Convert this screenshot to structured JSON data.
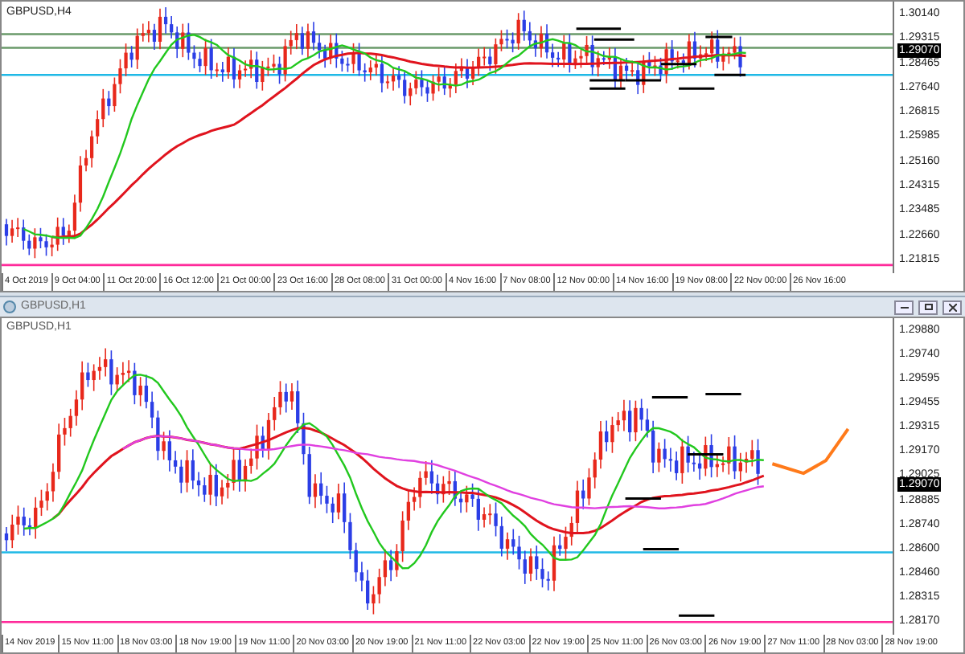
{
  "top_chart": {
    "title": "GBPUSD,H4",
    "price_tag": "1.29070",
    "price_axis": [
      "1.30140",
      "1.29315",
      "1.28465",
      "1.27640",
      "1.26815",
      "1.25985",
      "1.25160",
      "1.24315",
      "1.23485",
      "1.22660",
      "1.21815"
    ],
    "time_axis": [
      "4 Oct 2019",
      "9 Oct 04:00",
      "11 Oct 20:00",
      "16 Oct 12:00",
      "21 Oct 00:00",
      "23 Oct 16:00",
      "28 Oct 08:00",
      "31 Oct 00:00",
      "4 Nov 16:00",
      "7 Nov 08:00",
      "12 Nov 00:00",
      "14 Nov 16:00",
      "19 Nov 08:00",
      "22 Nov 00:00",
      "26 Nov 16:00"
    ]
  },
  "bottom_window": {
    "title": "GBPUSD,H1",
    "chart_title": "GBPUSD,H1",
    "price_tag": "1.29070",
    "price_axis": [
      "1.29880",
      "1.29740",
      "1.29595",
      "1.29455",
      "1.29315",
      "1.29170",
      "1.29025",
      "1.28885",
      "1.28740",
      "1.28600",
      "1.28460",
      "1.28315",
      "1.28170"
    ],
    "time_axis": [
      "14 Nov 2019",
      "15 Nov 11:00",
      "18 Nov 03:00",
      "18 Nov 19:00",
      "19 Nov 11:00",
      "20 Nov 03:00",
      "20 Nov 19:00",
      "21 Nov 11:00",
      "22 Nov 03:00",
      "22 Nov 19:00",
      "25 Nov 11:00",
      "26 Nov 03:00",
      "26 Nov 19:00",
      "27 Nov 11:00",
      "28 Nov 03:00",
      "28 Nov 19:00"
    ]
  }
}
